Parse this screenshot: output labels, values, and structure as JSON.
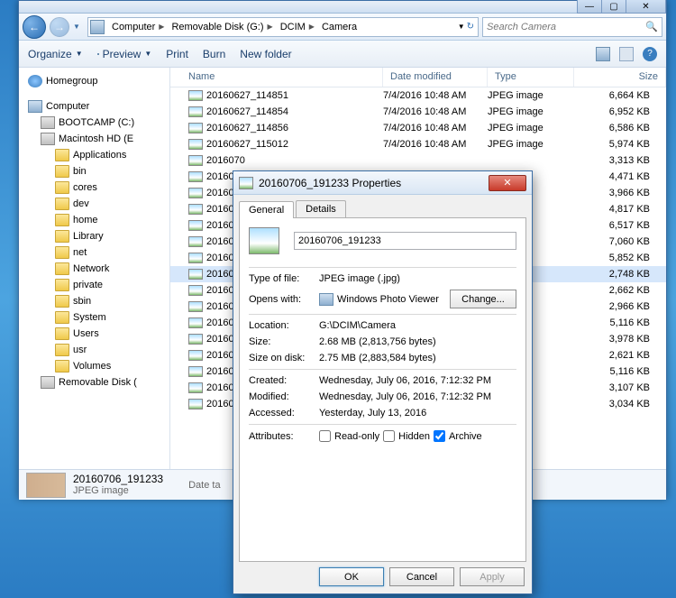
{
  "window_controls": {
    "min": "—",
    "max": "▢",
    "close": "✕"
  },
  "breadcrumb": {
    "segments": [
      "Computer",
      "Removable Disk (G:)",
      "DCIM",
      "Camera"
    ]
  },
  "search": {
    "placeholder": "Search Camera"
  },
  "toolbar": {
    "organize": "Organize",
    "preview": "Preview",
    "print": "Print",
    "burn": "Burn",
    "newfolder": "New folder"
  },
  "tree": [
    {
      "label": "Homegroup",
      "indent": 0,
      "icon": "hg"
    },
    {
      "spacer": true
    },
    {
      "label": "Computer",
      "indent": 0,
      "icon": "comp"
    },
    {
      "label": "BOOTCAMP (C:)",
      "indent": 1,
      "icon": "drive"
    },
    {
      "label": "Macintosh HD (E",
      "indent": 1,
      "icon": "drive"
    },
    {
      "label": "Applications",
      "indent": 2,
      "icon": "folder"
    },
    {
      "label": "bin",
      "indent": 2,
      "icon": "folder"
    },
    {
      "label": "cores",
      "indent": 2,
      "icon": "folder"
    },
    {
      "label": "dev",
      "indent": 2,
      "icon": "folder"
    },
    {
      "label": "home",
      "indent": 2,
      "icon": "folder"
    },
    {
      "label": "Library",
      "indent": 2,
      "icon": "folder"
    },
    {
      "label": "net",
      "indent": 2,
      "icon": "folder"
    },
    {
      "label": "Network",
      "indent": 2,
      "icon": "folder"
    },
    {
      "label": "private",
      "indent": 2,
      "icon": "folder"
    },
    {
      "label": "sbin",
      "indent": 2,
      "icon": "folder"
    },
    {
      "label": "System",
      "indent": 2,
      "icon": "folder"
    },
    {
      "label": "Users",
      "indent": 2,
      "icon": "folder"
    },
    {
      "label": "usr",
      "indent": 2,
      "icon": "folder"
    },
    {
      "label": "Volumes",
      "indent": 2,
      "icon": "folder"
    },
    {
      "label": "Removable Disk (",
      "indent": 1,
      "icon": "drive"
    }
  ],
  "columns": {
    "name": "Name",
    "date": "Date modified",
    "type": "Type",
    "size": "Size"
  },
  "files": [
    {
      "name": "20160627_114851",
      "date": "7/4/2016 10:48 AM",
      "type": "JPEG image",
      "size": "6,664 KB"
    },
    {
      "name": "20160627_114854",
      "date": "7/4/2016 10:48 AM",
      "type": "JPEG image",
      "size": "6,952 KB"
    },
    {
      "name": "20160627_114856",
      "date": "7/4/2016 10:48 AM",
      "type": "JPEG image",
      "size": "6,586 KB"
    },
    {
      "name": "20160627_115012",
      "date": "7/4/2016 10:48 AM",
      "type": "JPEG image",
      "size": "5,974 KB"
    },
    {
      "name": "2016070",
      "date": "",
      "type": "",
      "size": "3,313 KB"
    },
    {
      "name": "2016070",
      "date": "",
      "type": "",
      "size": "4,471 KB"
    },
    {
      "name": "2016070",
      "date": "",
      "type": "",
      "size": "3,966 KB"
    },
    {
      "name": "2016070",
      "date": "",
      "type": "",
      "size": "4,817 KB"
    },
    {
      "name": "2016070",
      "date": "",
      "type": "",
      "size": "6,517 KB"
    },
    {
      "name": "2016070",
      "date": "",
      "type": "",
      "size": "7,060 KB"
    },
    {
      "name": "2016070",
      "date": "",
      "type": "",
      "size": "5,852 KB"
    },
    {
      "name": "2016070",
      "date": "",
      "type": "",
      "size": "2,748 KB",
      "sel": true
    },
    {
      "name": "2016070",
      "date": "",
      "type": "",
      "size": "2,662 KB"
    },
    {
      "name": "2016071",
      "date": "",
      "type": "",
      "size": "2,966 KB"
    },
    {
      "name": "2016071",
      "date": "",
      "type": "",
      "size": "5,116 KB"
    },
    {
      "name": "2016070",
      "date": "",
      "type": "",
      "size": "3,978 KB"
    },
    {
      "name": "2016070",
      "date": "",
      "type": "",
      "size": "2,621 KB"
    },
    {
      "name": "2016071",
      "date": "",
      "type": "",
      "size": "5,116 KB"
    },
    {
      "name": "2016070",
      "date": "",
      "type": "",
      "size": "3,107 KB"
    },
    {
      "name": "2016070",
      "date": "",
      "type": "",
      "size": "3,034 KB"
    }
  ],
  "details": {
    "filename": "20160706_191233",
    "filetype": "JPEG image",
    "datetaken_label": "Date ta"
  },
  "dialog": {
    "title": "20160706_191233 Properties",
    "tabs": {
      "general": "General",
      "details": "Details"
    },
    "filename": "20160706_191233",
    "type_label": "Type of file:",
    "type_value": "JPEG image (.jpg)",
    "opens_label": "Opens with:",
    "opens_value": "Windows Photo Viewer",
    "change": "Change...",
    "location_label": "Location:",
    "location_value": "G:\\DCIM\\Camera",
    "size_label": "Size:",
    "size_value": "2.68 MB (2,813,756 bytes)",
    "sizeondisk_label": "Size on disk:",
    "sizeondisk_value": "2.75 MB (2,883,584 bytes)",
    "created_label": "Created:",
    "created_value": "Wednesday, July 06, 2016, 7:12:32 PM",
    "modified_label": "Modified:",
    "modified_value": "Wednesday, July 06, 2016, 7:12:32 PM",
    "accessed_label": "Accessed:",
    "accessed_value": "Yesterday, July 13, 2016",
    "attributes_label": "Attributes:",
    "readonly": "Read-only",
    "hidden": "Hidden",
    "archive": "Archive",
    "ok": "OK",
    "cancel": "Cancel",
    "apply": "Apply"
  }
}
